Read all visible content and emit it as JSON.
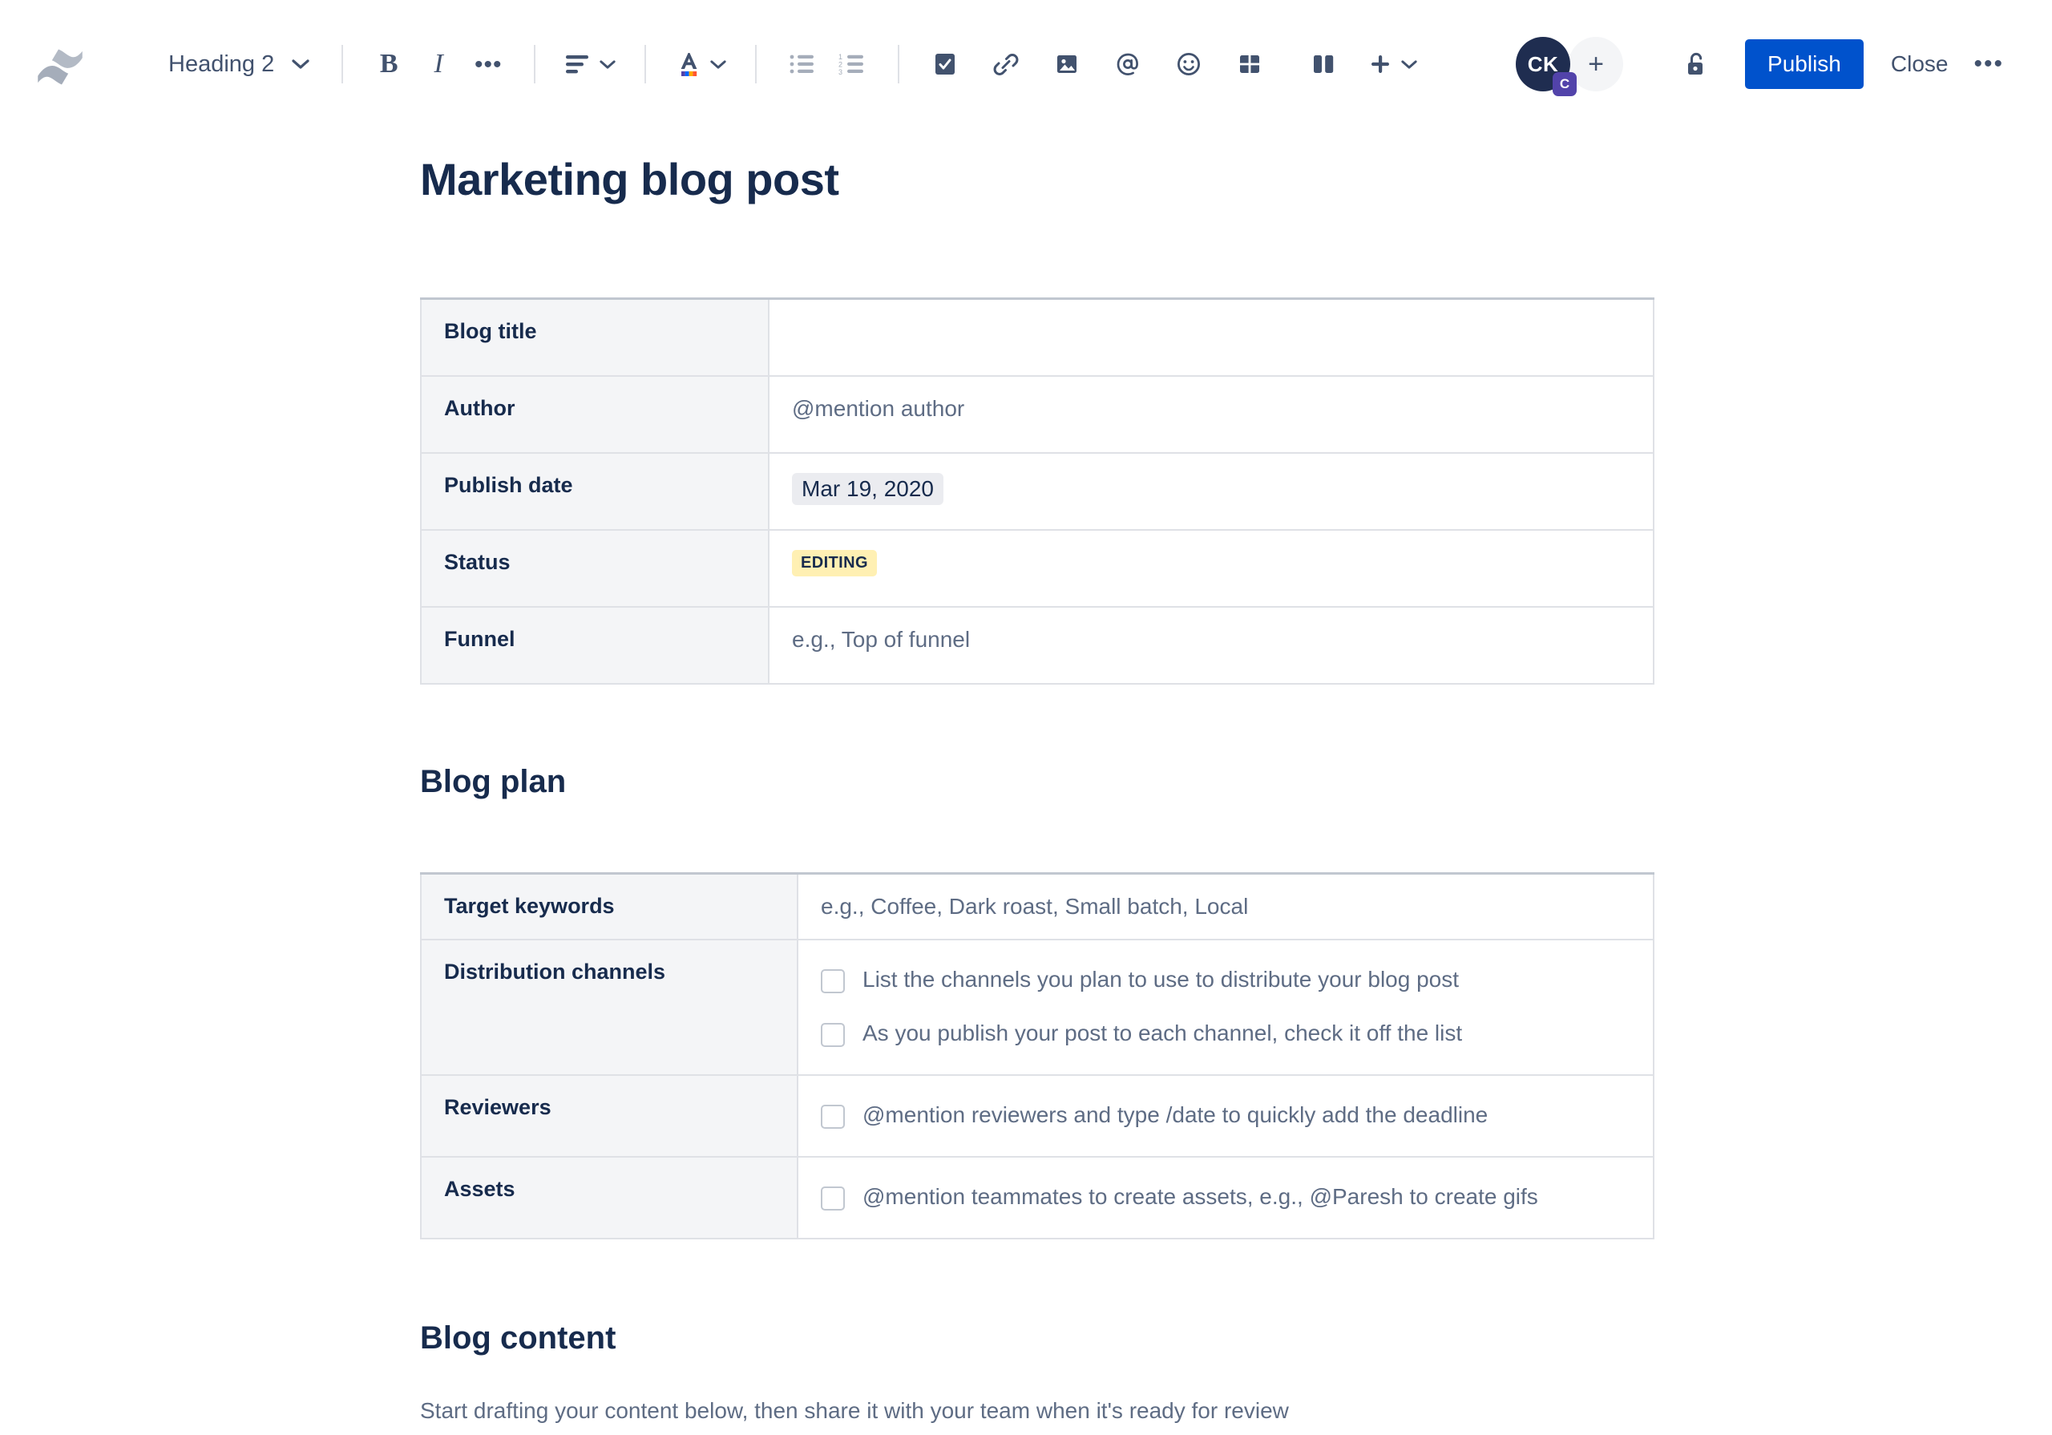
{
  "toolbar": {
    "logo_name": "confluence-logo",
    "block_type": "Heading 2",
    "bold_label": "B",
    "italic_label": "I",
    "more_formatting_label": "•••",
    "items": [
      {
        "name": "text-align-icon",
        "label": "Text align"
      },
      {
        "name": "text-color-icon",
        "label": "Text color"
      },
      {
        "name": "bullet-list-icon",
        "label": "Bullet list"
      },
      {
        "name": "numbered-list-icon",
        "label": "Numbered list"
      },
      {
        "name": "task-list-icon",
        "label": "Action item"
      },
      {
        "name": "link-icon",
        "label": "Link"
      },
      {
        "name": "image-icon",
        "label": "Image"
      },
      {
        "name": "mention-icon",
        "label": "Mention"
      },
      {
        "name": "emoji-icon",
        "label": "Emoji"
      },
      {
        "name": "table-icon",
        "label": "Table"
      },
      {
        "name": "layout-icon",
        "label": "Layout"
      },
      {
        "name": "insert-icon",
        "label": "Insert"
      }
    ],
    "avatar_initials": "CK",
    "avatar_badge": "C",
    "add_person_label": "+",
    "lock_label": "Restrictions",
    "publish_label": "Publish",
    "close_label": "Close",
    "more_label": "•••",
    "accent_color": "#0052CC"
  },
  "document": {
    "title": "Marketing blog post",
    "details_table": {
      "rows": [
        {
          "label": "Blog title",
          "value": "",
          "kind": "text"
        },
        {
          "label": "Author",
          "value": "@mention author",
          "kind": "text"
        },
        {
          "label": "Publish date",
          "value": "Mar 19, 2020",
          "kind": "date-pill"
        },
        {
          "label": "Status",
          "value": "EDITING",
          "kind": "status-badge"
        },
        {
          "label": "Funnel",
          "value": "e.g., Top of funnel",
          "kind": "text"
        }
      ]
    },
    "blog_plan_heading": "Blog plan",
    "plan_table": {
      "rows": [
        {
          "label": "Target keywords",
          "kind": "text",
          "value": "e.g., Coffee, Dark roast, Small batch, Local"
        },
        {
          "label": "Distribution channels",
          "kind": "tasks",
          "tasks": [
            {
              "text": "List the channels you plan to use to distribute your blog post",
              "checked": false
            },
            {
              "text": "As you publish your post to each channel, check it off the list",
              "checked": false
            }
          ]
        },
        {
          "label": "Reviewers",
          "kind": "tasks",
          "tasks": [
            {
              "text": "@mention reviewers and type /date to quickly add the deadline",
              "checked": false
            }
          ]
        },
        {
          "label": "Assets",
          "kind": "tasks",
          "tasks": [
            {
              "text": "@mention teammates to create assets, e.g., @Paresh to create gifs",
              "checked": false
            }
          ]
        }
      ]
    },
    "blog_content_heading": "Blog content",
    "blog_content_text": "Start drafting your content below, then share it with your team when it's ready for review"
  },
  "colors": {
    "status_badge_bg": "#FFF0B3",
    "date_pill_bg": "#EBECF0",
    "table_label_bg": "#F4F5F7",
    "table_border": "#DFE1E6",
    "heading": "#172B4D",
    "body": "#5E6C84"
  }
}
